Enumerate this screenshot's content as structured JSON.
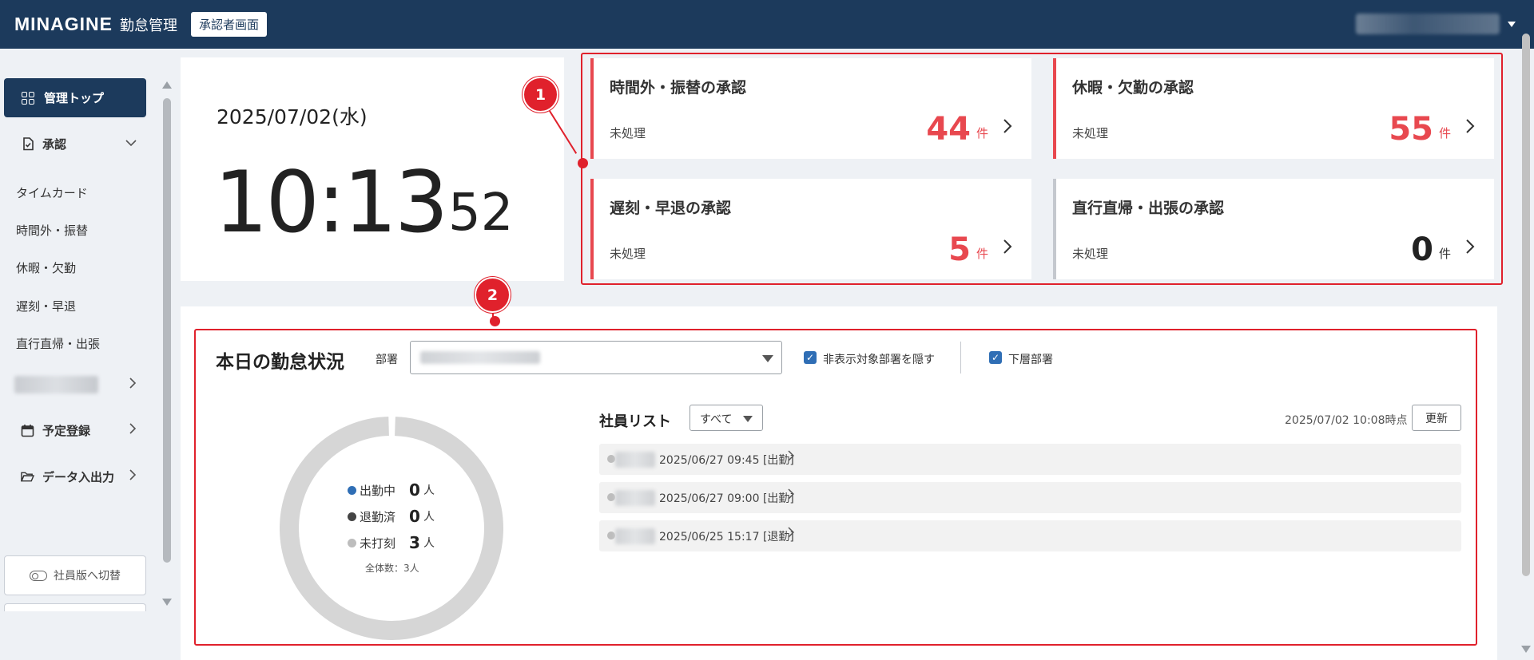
{
  "header": {
    "logo": "MINAGINE",
    "app_name": "勤怠管理",
    "mode_badge": "承認者画面"
  },
  "sidebar": {
    "active": "管理トップ",
    "approval_group": "承認",
    "approval_items": [
      "タイムカード",
      "時間外・振替",
      "休暇・欠勤",
      "遅刻・早退",
      "直行直帰・出張"
    ],
    "schedule": "予定登録",
    "data_io": "データ入出力",
    "switch_button": "社員版へ切替"
  },
  "clock": {
    "date": "2025/07/02(水)",
    "hm": "10:13",
    "sec": "52"
  },
  "approvals": [
    {
      "title": "時間外・振替の承認",
      "label": "未処理",
      "count": "44",
      "unit": "件"
    },
    {
      "title": "休暇・欠勤の承認",
      "label": "未処理",
      "count": "55",
      "unit": "件"
    },
    {
      "title": "遅刻・早退の承認",
      "label": "未処理",
      "count": "5",
      "unit": "件"
    },
    {
      "title": "直行直帰・出張の承認",
      "label": "未処理",
      "count": "0",
      "unit": "件"
    }
  ],
  "callouts": [
    "1",
    "2"
  ],
  "attendance": {
    "title": "本日の勤怠状況",
    "dept_label": "部署",
    "hide_checkbox": "非表示対象部署を隠す",
    "sub_checkbox": "下層部署",
    "legend": [
      {
        "label": "出勤中",
        "value": "0",
        "unit": "人",
        "color": "#2f6eb5"
      },
      {
        "label": "退勤済",
        "value": "0",
        "unit": "人",
        "color": "#444444"
      },
      {
        "label": "未打刻",
        "value": "3",
        "unit": "人",
        "color": "#bdbdbd"
      }
    ],
    "total": "全体数：3人",
    "emp_list_title": "社員リスト",
    "filter": "すべて",
    "as_of": "2025/07/02 10:08時点",
    "refresh": "更新",
    "rows": [
      {
        "time": "2025/06/27 09:45 [出勤]"
      },
      {
        "time": "2025/06/27 09:00 [出勤]"
      },
      {
        "time": "2025/06/25 15:17 [退勤]"
      }
    ]
  },
  "colors": {
    "header": "#1c3a5c",
    "accent_red": "#e8484f",
    "annotation_red": "#e0212c",
    "check_blue": "#2f6eb5"
  }
}
